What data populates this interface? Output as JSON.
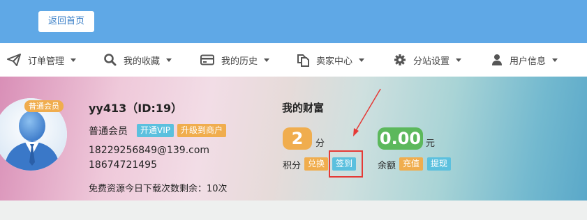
{
  "header": {
    "home_button": "返回首页",
    "bg_color": "#5fa8e6"
  },
  "nav": {
    "items": [
      {
        "label": "订单管理",
        "icon": "paper-plane-icon"
      },
      {
        "label": "我的收藏",
        "icon": "search-icon"
      },
      {
        "label": "我的历史",
        "icon": "credit-card-icon"
      },
      {
        "label": "卖家中心",
        "icon": "copy-icon"
      },
      {
        "label": "分站设置",
        "icon": "gear-icon"
      },
      {
        "label": "用户信息",
        "icon": "user-icon"
      }
    ]
  },
  "profile": {
    "member_tag": "普通会员",
    "username": "yy413",
    "user_id": "（ID:19）",
    "level": "普通会员",
    "open_vip": "开通VIP",
    "upgrade_merchant": "升级到商户",
    "email": "18229256849@139.com",
    "phone": "18674721495",
    "downloads_left": "免费资源今日下载次数剩余：10次"
  },
  "wealth": {
    "title": "我的财富",
    "points_value": "2",
    "points_unit": "分",
    "points_label": "积分",
    "exchange_button": "兑换",
    "signin_button": "签到",
    "balance_value": "0.00",
    "balance_unit": "元",
    "balance_label": "余额",
    "recharge_button": "充值",
    "withdraw_button": "提现"
  },
  "colors": {
    "orange": "#f0ad4e",
    "cyan": "#5bc0de",
    "green": "#5cb85c",
    "annotation_red": "#e53935"
  }
}
